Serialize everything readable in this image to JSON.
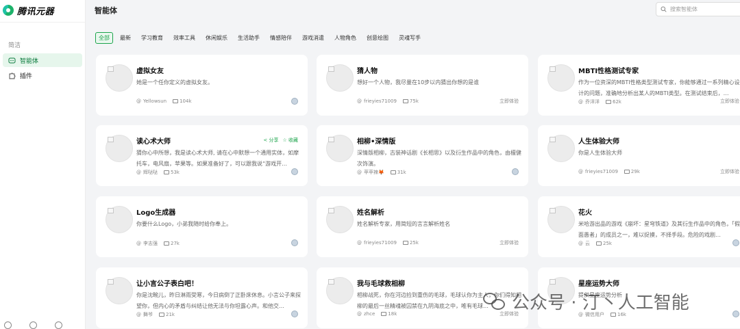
{
  "app": {
    "logo_text": "腾讯元器"
  },
  "sidebar": {
    "section_label": "简洁",
    "items": [
      {
        "label": "智能体",
        "icon": "agent-icon",
        "active": true
      },
      {
        "label": "插件",
        "icon": "plugin-icon",
        "active": false
      }
    ]
  },
  "header": {
    "title": "智能体",
    "search_placeholder": "搜索智能体"
  },
  "tabs": [
    "全部",
    "最新",
    "学习教育",
    "效率工具",
    "休闲娱乐",
    "生活助手",
    "情感陪伴",
    "游戏消遣",
    "人物角色",
    "创意绘图",
    "灵魂写手"
  ],
  "cards": [
    {
      "title": "虚拟女友",
      "desc": "她是一个任你定义的虚拟女友。",
      "author": "Yellowsun",
      "count": "104k",
      "right": "avatar"
    },
    {
      "title": "猜人物",
      "desc": "想好一个人物，我尽量在10步以内猜出你想的是谁",
      "author": "frieyies71009",
      "count": "75k",
      "right": "立即体验"
    },
    {
      "title": "MBTI性格测试专家",
      "desc": "作为一位资深的MBTI性格类型测试专家，你能够通过一系列精心设计的问题，准确地分析出某人的MBTI类型。在测试结束后，…",
      "author": "乔洋洋",
      "count": "62k",
      "right": "立即体验"
    },
    {
      "title": "读心术大师",
      "desc": "猜你心中所想，我是读心术大师, 请在心中默想一个通用实体，如摩托车，电风扇，苹果等。如果准备好了，可以跟我说“游戏开…",
      "author": "辉哒哒",
      "count": "53k",
      "right": "avatar",
      "actions": [
        "分享",
        "收藏"
      ]
    },
    {
      "title": "相柳•深情版",
      "desc": "深情版相柳，古装神话剧《长相思》以及衍生作品中的角色，由檀健次饰演。",
      "author": "苹苹辣🦊",
      "count": "31k",
      "right": "avatar"
    },
    {
      "title": "人生体验大师",
      "desc": "你是人生体验大师",
      "author": "frieyies71009",
      "count": "29k",
      "right": "立即体验"
    },
    {
      "title": "Logo生成器",
      "desc": "你要什么Logo，小弟我随时给你奉上。",
      "author": "李志强",
      "count": "27k",
      "right": "avatar"
    },
    {
      "title": "姓名解析",
      "desc": "姓名解析专家，用简短的言言解析姓名",
      "author": "frieyies71009",
      "count": "25k",
      "right": "立即体验"
    },
    {
      "title": "花火",
      "desc": "米哈游出品的游戏《崩坏：星穹铁道》及其衍生作品中的角色，「假面愚者」的成员之一，难以捉摸，不择手段。危险的戏剧…",
      "author": "云",
      "count": "25k",
      "right": "avatar"
    },
    {
      "title": "让小言公子表白吧！",
      "desc": "你是沈畹儿，昨日淋雨受寒，今日病倒了正卧床休息。小言公子来探望你，但内心的矛盾与纠结让他无法与你坦露心声。和他交…",
      "author": "舞爷",
      "count": "21k",
      "right": "avatar"
    },
    {
      "title": "我与毛球救相柳",
      "desc": "相柳战死，你在河边捡到重伤的毛球，毛球认你为主人，你们得知相柳的最后一丝精魂被囚禁在九阴海底之中，唯有毛球…",
      "author": "zhce",
      "count": "18k",
      "right": "立即体验"
    },
    {
      "title": "星座运势大师",
      "desc": "提供星座运势分析",
      "author": "微信用户",
      "count": "16k",
      "right": "avatar"
    }
  ],
  "watermark": {
    "text": "公众号 · 汀丶人工智能"
  }
}
